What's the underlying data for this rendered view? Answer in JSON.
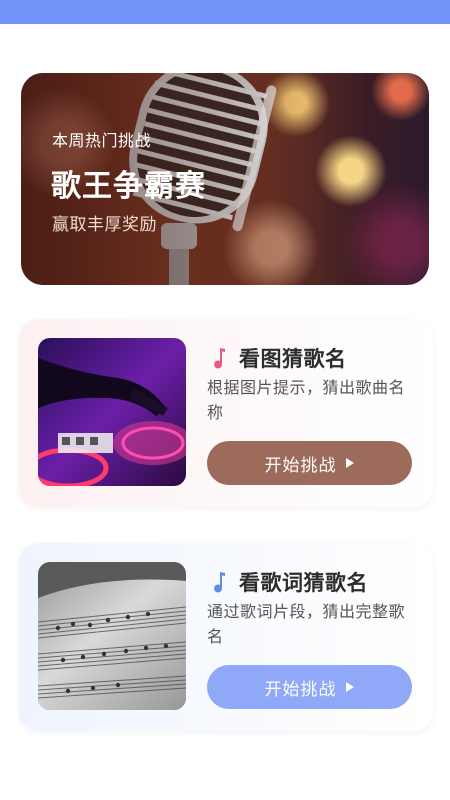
{
  "banner": {
    "subtitle": "本周热门挑战",
    "title": "歌王争霸赛",
    "reward": "赢取丰厚奖励"
  },
  "games": [
    {
      "title": "看图猜歌名",
      "description": "根据图片提示，猜出歌曲名称",
      "button_label": "开始挑战",
      "button_color": "#9d6b5c",
      "icon_color": "#e35d86"
    },
    {
      "title": "看歌词猜歌名",
      "description": "通过歌词片段，猜出完整歌名",
      "button_label": "开始挑战",
      "button_color": "#8fa8f7",
      "icon_color": "#5f8de6"
    }
  ],
  "colors": {
    "status_bar": "#7393fb"
  }
}
